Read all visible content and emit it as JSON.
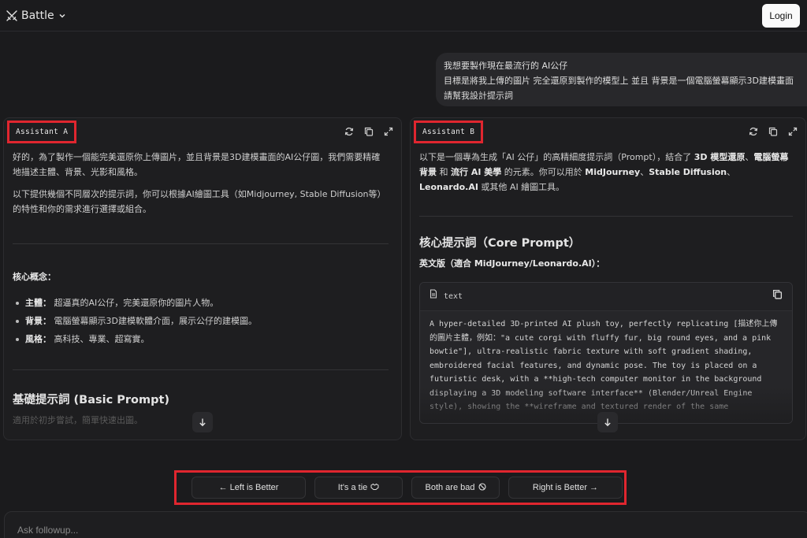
{
  "header": {
    "brand": "Battle",
    "login_label": "Login"
  },
  "user_message": {
    "lines": [
      "我想要製作現在最流行的 AI公仔",
      "目標是將我上傳的圖片 完全還原到製作的模型上 並且 背景是一個電腦螢幕顯示3D建模畫面",
      "請幫我設計提示詞"
    ]
  },
  "panel_a": {
    "label": "Assistant A",
    "intro_1": "好的，為了製作一個能完美還原你上傳圖片，並且背景是3D建模畫面的AI公仔圖，我們需要精確地描述主體、背景、光影和風格。",
    "intro_2": "以下提供幾個不同層次的提示詞，你可以根據AI繪圖工具（如Midjourney, Stable Diffusion等）的特性和你的需求進行選擇或組合。",
    "core_heading": "核心概念：",
    "concepts": [
      {
        "term": "主體：",
        "desc": "超逼真的AI公仔，完美還原你的圖片人物。"
      },
      {
        "term": "背景：",
        "desc": "電腦螢幕顯示3D建模軟體介面，展示公仔的建模圖。"
      },
      {
        "term": "風格：",
        "desc": "高科技、專業、超寫實。"
      }
    ],
    "basic_heading": "基礎提示詞 (Basic Prompt)",
    "faded_line": "適用於初步嘗試，簡單快速出圖。"
  },
  "panel_b": {
    "label": "Assistant B",
    "intro": {
      "p1": "以下是一個專為生成「AI 公仔」的高精細度提示詞（Prompt），結合了 ",
      "b1": "3D 模型還原",
      "p2": "、",
      "b2": "電腦螢幕背景",
      "p3": " 和 ",
      "b3": "流行 AI 美學",
      "p4": " 的元素。你可以用於 ",
      "b4": "MidJourney",
      "p5": "、",
      "b5": "Stable Diffusion",
      "p6": "、",
      "b6": "Leonardo.AI",
      "p7": " 或其他 AI 繪圖工具。"
    },
    "core_heading": "核心提示詞（Core Prompt）",
    "version_label": "英文版（適合 MidJourney/Leonardo.AI）：",
    "code_lang": "text",
    "code_text": "A hyper-detailed 3D-printed AI plush toy, perfectly replicating [描述你上傳的圖片主體，例如：\"a cute corgi with fluffy fur, big round eyes, and a pink bowtie\"], ultra-realistic fabric texture with soft gradient shading, embroidered facial features, and dynamic pose. The toy is placed on a futuristic desk, with a **high-tech computer monitor in the background displaying a 3D modeling software interface** (Blender/Unreal Engine style), showing the **wireframe and textured render of the same"
  },
  "vote": {
    "left": "← Left is Better",
    "tie": "It's a tie",
    "bad": "Both are bad",
    "right": "Right is Better →"
  },
  "followup": {
    "placeholder": "Ask followup..."
  }
}
